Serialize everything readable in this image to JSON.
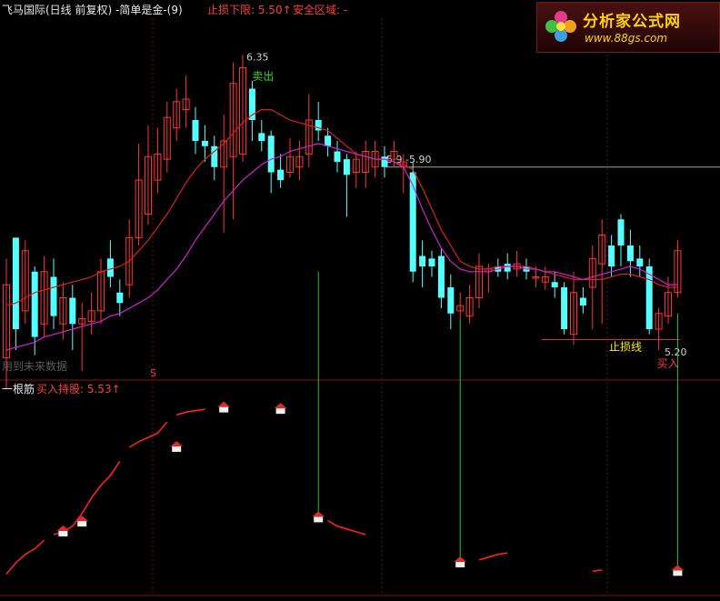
{
  "header": {
    "stock_title": "飞马国际(日线 前复权) -简单是金-(9)",
    "stop_lower": "止损下限: 5.50↑",
    "safe_zone": "安全区域: -",
    "future_note": "用到未来数据"
  },
  "subpanel": {
    "title": "一根筋",
    "buy_hold": "买入持股: 5.53↑"
  },
  "watermark": {
    "brand": "分析家公式网",
    "url": "www.88gs.com"
  },
  "colors": {
    "up": "#ff3333",
    "down": "#54ffff",
    "hold": "#ffee00",
    "weak": "#1a1aff",
    "ma_red": "#dd1f1f",
    "ma_magenta": "#d21fd2",
    "stop_line": "#c83232",
    "level_line": "#a0a0a0",
    "signal_line": "#22c822",
    "separator": "#8a1010",
    "vgrid": "#6a1515"
  },
  "chart_data": {
    "type": "candlestick",
    "annotations": {
      "peak_label": "6.35",
      "sell_label": "卖出",
      "level_label": "5.9 -5.90",
      "stop_line_label": "止损线",
      "low_label": "5.20",
      "buy_label": "买入",
      "marker_label": "S"
    },
    "candles": [
      {
        "o": 5.17,
        "c": 5.45,
        "h": 5.55,
        "l": 5.05,
        "k": "up"
      },
      {
        "o": 5.63,
        "c": 5.28,
        "h": 5.63,
        "l": 5.2,
        "k": "down"
      },
      {
        "o": 5.35,
        "c": 5.58,
        "h": 5.62,
        "l": 5.3,
        "k": "up"
      },
      {
        "o": 5.5,
        "c": 5.25,
        "h": 5.52,
        "l": 5.18,
        "k": "down"
      },
      {
        "o": 5.3,
        "c": 5.5,
        "h": 5.56,
        "l": 5.25,
        "k": "up"
      },
      {
        "o": 5.48,
        "c": 5.33,
        "h": 5.55,
        "l": 5.28,
        "k": "down"
      },
      {
        "o": 5.3,
        "c": 5.4,
        "h": 5.46,
        "l": 5.24,
        "k": "up"
      },
      {
        "o": 5.4,
        "c": 5.3,
        "h": 5.45,
        "l": 5.2,
        "k": "down"
      },
      {
        "o": 5.3,
        "c": 5.32,
        "h": 5.38,
        "l": 5.12,
        "k": "up"
      },
      {
        "o": 5.31,
        "c": 5.35,
        "h": 5.42,
        "l": 5.26,
        "k": "up"
      },
      {
        "o": 5.35,
        "c": 5.5,
        "h": 5.55,
        "l": 5.3,
        "k": "up"
      },
      {
        "o": 5.55,
        "c": 5.48,
        "h": 5.62,
        "l": 5.44,
        "k": "down"
      },
      {
        "o": 5.42,
        "c": 5.38,
        "h": 5.47,
        "l": 5.33,
        "k": "down"
      },
      {
        "o": 5.45,
        "c": 5.63,
        "h": 5.7,
        "l": 5.4,
        "k": "up"
      },
      {
        "o": 5.63,
        "c": 5.85,
        "h": 5.99,
        "l": 5.6,
        "k": "up"
      },
      {
        "o": 5.72,
        "c": 5.94,
        "h": 6.06,
        "l": 5.68,
        "k": "up"
      },
      {
        "o": 5.85,
        "c": 5.95,
        "h": 6.05,
        "l": 5.8,
        "k": "up"
      },
      {
        "o": 5.93,
        "c": 6.09,
        "h": 6.15,
        "l": 5.88,
        "k": "up"
      },
      {
        "o": 6.05,
        "c": 6.15,
        "h": 6.2,
        "l": 6.0,
        "k": "up"
      },
      {
        "o": 6.12,
        "c": 6.16,
        "h": 6.25,
        "l": 6.05,
        "k": "up"
      },
      {
        "o": 6.08,
        "c": 6.0,
        "h": 6.13,
        "l": 5.95,
        "k": "down"
      },
      {
        "o": 6.0,
        "c": 5.98,
        "h": 6.06,
        "l": 5.92,
        "k": "down"
      },
      {
        "o": 5.98,
        "c": 5.9,
        "h": 6.02,
        "l": 5.85,
        "k": "down"
      },
      {
        "o": 5.9,
        "c": 6.0,
        "h": 6.1,
        "l": 5.65,
        "k": "up"
      },
      {
        "o": 5.94,
        "c": 6.22,
        "h": 6.3,
        "l": 5.7,
        "k": "up"
      },
      {
        "o": 5.95,
        "c": 6.28,
        "h": 6.33,
        "l": 5.92,
        "k": "up"
      },
      {
        "o": 6.2,
        "c": 6.08,
        "h": 6.23,
        "l": 6.0,
        "k": "down"
      },
      {
        "o": 6.03,
        "c": 6.0,
        "h": 6.08,
        "l": 5.96,
        "k": "down"
      },
      {
        "o": 6.02,
        "c": 5.88,
        "h": 6.04,
        "l": 5.8,
        "k": "down"
      },
      {
        "o": 5.89,
        "c": 5.85,
        "h": 5.95,
        "l": 5.82,
        "k": "down"
      },
      {
        "o": 5.88,
        "c": 5.94,
        "h": 6.01,
        "l": 5.86,
        "k": "up"
      },
      {
        "o": 5.9,
        "c": 5.94,
        "h": 6.0,
        "l": 5.85,
        "k": "up"
      },
      {
        "o": 5.95,
        "c": 6.08,
        "h": 6.18,
        "l": 5.9,
        "k": "up"
      },
      {
        "o": 6.08,
        "c": 6.04,
        "h": 6.15,
        "l": 6.0,
        "k": "down"
      },
      {
        "o": 6.02,
        "c": 5.98,
        "h": 6.05,
        "l": 5.94,
        "k": "down"
      },
      {
        "o": 5.96,
        "c": 5.92,
        "h": 6.0,
        "l": 5.88,
        "k": "down"
      },
      {
        "o": 5.93,
        "c": 5.87,
        "h": 5.95,
        "l": 5.71,
        "k": "down"
      },
      {
        "o": 5.88,
        "c": 5.93,
        "h": 5.96,
        "l": 5.82,
        "k": "up"
      },
      {
        "o": 5.88,
        "c": 5.96,
        "h": 6.0,
        "l": 5.82,
        "k": "up"
      },
      {
        "o": 5.9,
        "c": 5.96,
        "h": 6.0,
        "l": 5.86,
        "k": "up"
      },
      {
        "o": 5.94,
        "c": 5.9,
        "h": 5.98,
        "l": 5.86,
        "k": "down"
      },
      {
        "o": 5.93,
        "c": 5.96,
        "h": 6.0,
        "l": 5.9,
        "k": "up"
      },
      {
        "o": 5.92,
        "c": 5.9,
        "h": 5.95,
        "l": 5.8,
        "k": "up"
      },
      {
        "o": 5.88,
        "c": 5.5,
        "h": 5.92,
        "l": 5.46,
        "k": "down"
      },
      {
        "o": 5.56,
        "c": 5.52,
        "h": 5.62,
        "l": 5.44,
        "k": "down"
      },
      {
        "o": 5.55,
        "c": 5.52,
        "h": 5.58,
        "l": 5.48,
        "k": "down"
      },
      {
        "o": 5.56,
        "c": 5.4,
        "h": 5.59,
        "l": 5.36,
        "k": "down"
      },
      {
        "o": 5.44,
        "c": 5.34,
        "h": 5.49,
        "l": 5.28,
        "k": "down"
      },
      {
        "o": 5.35,
        "c": 5.37,
        "h": 5.42,
        "l": 5.32,
        "k": "up"
      },
      {
        "o": 5.33,
        "c": 5.4,
        "h": 5.45,
        "l": 5.3,
        "k": "up"
      },
      {
        "o": 5.4,
        "c": 5.52,
        "h": 5.57,
        "l": 5.36,
        "k": "up"
      },
      {
        "o": 5.5,
        "c": 5.51,
        "h": 5.53,
        "l": 5.42,
        "k": "up"
      },
      {
        "o": 5.52,
        "c": 5.5,
        "h": 5.55,
        "l": 5.48,
        "k": "down"
      },
      {
        "o": 5.53,
        "c": 5.5,
        "h": 5.57,
        "l": 5.47,
        "k": "down"
      },
      {
        "o": 5.51,
        "c": 5.53,
        "h": 5.58,
        "l": 5.48,
        "k": "up"
      },
      {
        "o": 5.52,
        "c": 5.5,
        "h": 5.55,
        "l": 5.47,
        "k": "down"
      },
      {
        "o": 5.48,
        "c": 5.48,
        "h": 5.52,
        "l": 5.44,
        "k": "up"
      },
      {
        "o": 5.46,
        "c": 5.48,
        "h": 5.52,
        "l": 5.43,
        "k": "up"
      },
      {
        "o": 5.46,
        "c": 5.44,
        "h": 5.5,
        "l": 5.4,
        "k": "down"
      },
      {
        "o": 5.44,
        "c": 5.28,
        "h": 5.46,
        "l": 5.26,
        "k": "down"
      },
      {
        "o": 5.26,
        "c": 5.42,
        "h": 5.5,
        "l": 5.22,
        "k": "up"
      },
      {
        "o": 5.4,
        "c": 5.37,
        "h": 5.44,
        "l": 5.34,
        "k": "down"
      },
      {
        "o": 5.44,
        "c": 5.55,
        "h": 5.6,
        "l": 5.28,
        "k": "up"
      },
      {
        "o": 5.53,
        "c": 5.64,
        "h": 5.7,
        "l": 5.3,
        "k": "up"
      },
      {
        "o": 5.6,
        "c": 5.52,
        "h": 5.64,
        "l": 5.48,
        "k": "down"
      },
      {
        "o": 5.7,
        "c": 5.6,
        "h": 5.72,
        "l": 5.52,
        "k": "down"
      },
      {
        "o": 5.6,
        "c": 5.54,
        "h": 5.66,
        "l": 5.48,
        "k": "down"
      },
      {
        "o": 5.55,
        "c": 5.52,
        "h": 5.6,
        "l": 5.48,
        "k": "down"
      },
      {
        "o": 5.52,
        "c": 5.28,
        "h": 5.55,
        "l": 5.26,
        "k": "down"
      },
      {
        "o": 5.28,
        "c": 5.34,
        "h": 5.36,
        "l": 5.2,
        "k": "up"
      },
      {
        "o": 5.33,
        "c": 5.42,
        "h": 5.48,
        "l": 5.3,
        "k": "up"
      },
      {
        "o": 5.42,
        "c": 5.58,
        "h": 5.62,
        "l": 5.4,
        "k": "up"
      }
    ],
    "ma_red": [
      5.37,
      5.38,
      5.4,
      5.42,
      5.43,
      5.44,
      5.45,
      5.46,
      5.47,
      5.48,
      5.5,
      5.51,
      5.52,
      5.54,
      5.58,
      5.62,
      5.67,
      5.72,
      5.78,
      5.84,
      5.89,
      5.93,
      5.96,
      5.99,
      6.03,
      6.07,
      6.1,
      6.12,
      6.12,
      6.1,
      6.08,
      6.07,
      6.06,
      6.05,
      6.04,
      6.01,
      5.98,
      5.95,
      5.94,
      5.93,
      5.93,
      5.92,
      5.91,
      5.89,
      5.82,
      5.74,
      5.66,
      5.6,
      5.54,
      5.52,
      5.51,
      5.51,
      5.52,
      5.52,
      5.52,
      5.52,
      5.51,
      5.5,
      5.49,
      5.48,
      5.47,
      5.47,
      5.47,
      5.47,
      5.48,
      5.49,
      5.49,
      5.48,
      5.47,
      5.45,
      5.44,
      5.44
    ],
    "ma_magenta": [
      5.2,
      5.21,
      5.22,
      5.23,
      5.25,
      5.26,
      5.27,
      5.28,
      5.29,
      5.3,
      5.31,
      5.33,
      5.34,
      5.36,
      5.38,
      5.4,
      5.43,
      5.47,
      5.51,
      5.56,
      5.62,
      5.67,
      5.72,
      5.77,
      5.81,
      5.85,
      5.88,
      5.91,
      5.93,
      5.94,
      5.96,
      5.97,
      5.98,
      5.99,
      5.98,
      5.97,
      5.96,
      5.95,
      5.94,
      5.93,
      5.93,
      5.92,
      5.9,
      5.83,
      5.74,
      5.66,
      5.59,
      5.54,
      5.51,
      5.5,
      5.5,
      5.5,
      5.51,
      5.52,
      5.52,
      5.51,
      5.51,
      5.5,
      5.5,
      5.49,
      5.48,
      5.47,
      5.48,
      5.49,
      5.5,
      5.51,
      5.52,
      5.51,
      5.49,
      5.47,
      5.45,
      5.45
    ],
    "price_range": [
      5.12,
      6.4
    ],
    "level_price": 5.9,
    "stop_price": 5.24,
    "sub_segments": [
      [
        [
          0,
          0.12
        ],
        [
          1,
          0.2
        ],
        [
          2,
          0.26
        ],
        [
          3,
          0.3
        ],
        [
          4,
          0.36
        ]
      ],
      [
        [
          5,
          0.4
        ],
        [
          6,
          0.42
        ],
        [
          7,
          0.46
        ],
        [
          8,
          0.55
        ],
        [
          9,
          0.66
        ],
        [
          10,
          0.75
        ],
        [
          11,
          0.82
        ],
        [
          12,
          0.92
        ]
      ],
      [
        [
          13,
          1.02
        ],
        [
          14,
          1.06
        ],
        [
          15,
          1.09
        ],
        [
          16,
          1.12
        ],
        [
          17,
          1.2
        ]
      ],
      [
        [
          18,
          1.25
        ],
        [
          19,
          1.27
        ],
        [
          20,
          1.28
        ],
        [
          21,
          1.29
        ]
      ],
      [
        [
          34,
          0.5
        ],
        [
          35,
          0.46
        ],
        [
          36,
          0.44
        ],
        [
          37,
          0.42
        ],
        [
          38,
          0.4
        ]
      ],
      [
        [
          50,
          0.22
        ],
        [
          51,
          0.24
        ],
        [
          52,
          0.26
        ],
        [
          53,
          0.27
        ]
      ],
      [
        [
          62,
          0.14
        ],
        [
          63,
          0.15
        ]
      ]
    ],
    "sub_houses": [
      [
        6,
        0.42
      ],
      [
        8,
        0.49
      ],
      [
        18,
        1.02
      ],
      [
        23,
        1.3
      ],
      [
        29,
        1.29
      ],
      [
        33,
        0.52
      ],
      [
        48,
        0.2
      ],
      [
        71,
        0.14
      ]
    ],
    "sub_range": [
      0,
      1.42
    ],
    "signal_lines": [
      [
        33,
        5.5,
        0.52
      ],
      [
        48,
        5.32,
        0.2
      ],
      [
        71,
        5.34,
        0.14
      ]
    ]
  }
}
